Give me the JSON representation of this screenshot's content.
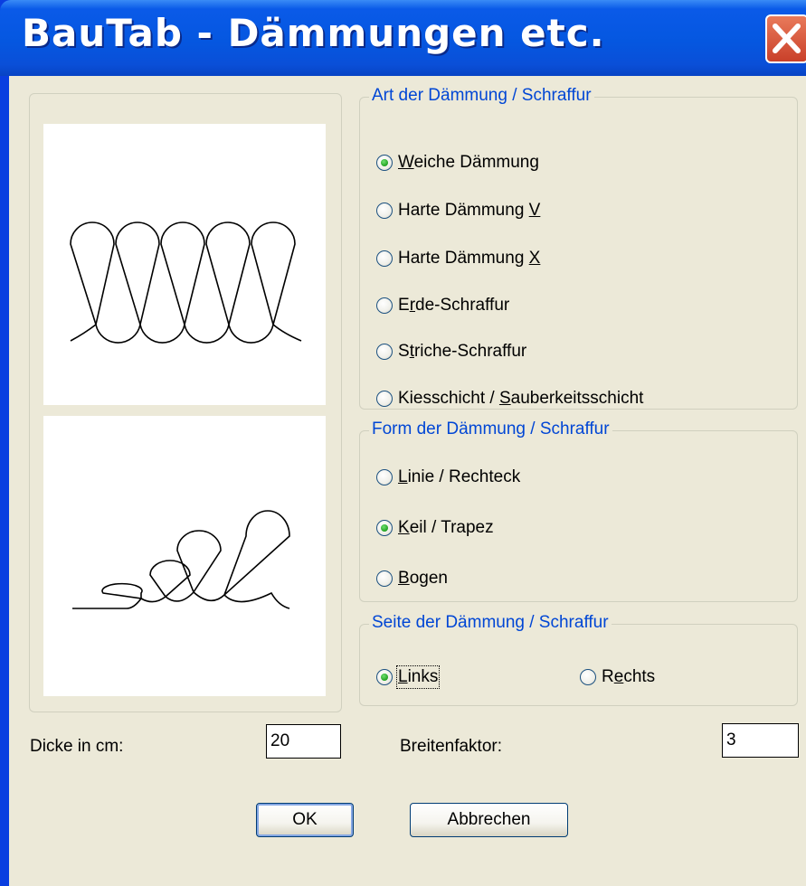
{
  "window": {
    "title": "BauTab - Dämmungen etc."
  },
  "group_art": {
    "legend": "Art der Dämmung / Schraffur",
    "options": [
      {
        "pre": "",
        "ak": "W",
        "post": "eiche Dämmung",
        "checked": true
      },
      {
        "pre": "Harte Dämmung ",
        "ak": "V",
        "post": "",
        "checked": false
      },
      {
        "pre": "Harte Dämmung ",
        "ak": "X",
        "post": "",
        "checked": false
      },
      {
        "pre": "E",
        "ak": "r",
        "post": "de-Schraffur",
        "checked": false
      },
      {
        "pre": "S",
        "ak": "t",
        "post": "riche-Schraffur",
        "checked": false
      },
      {
        "pre": "Kiesschicht / ",
        "ak": "S",
        "post": "auberkeitsschicht",
        "checked": false
      }
    ]
  },
  "group_form": {
    "legend": "Form der Dämmung / Schraffur",
    "options": [
      {
        "pre": "",
        "ak": "L",
        "post": "inie / Rechteck",
        "checked": false
      },
      {
        "pre": "",
        "ak": "K",
        "post": "eil / Trapez",
        "checked": true
      },
      {
        "pre": "",
        "ak": "B",
        "post": "ogen",
        "checked": false
      }
    ]
  },
  "group_seite": {
    "legend": "Seite der Dämmung / Schraffur",
    "options": [
      {
        "pre": "",
        "ak": "L",
        "post": "inks",
        "checked": true
      },
      {
        "pre": "R",
        "ak": "e",
        "post": "chts",
        "checked": false
      }
    ]
  },
  "fields": {
    "dicke_label": "Dicke in cm:",
    "dicke_value": "20",
    "breite_label": "Breitenfaktor:",
    "breite_value": "3"
  },
  "buttons": {
    "ok": "OK",
    "cancel": "Abbrechen"
  },
  "icons": {
    "close": "close-icon"
  }
}
